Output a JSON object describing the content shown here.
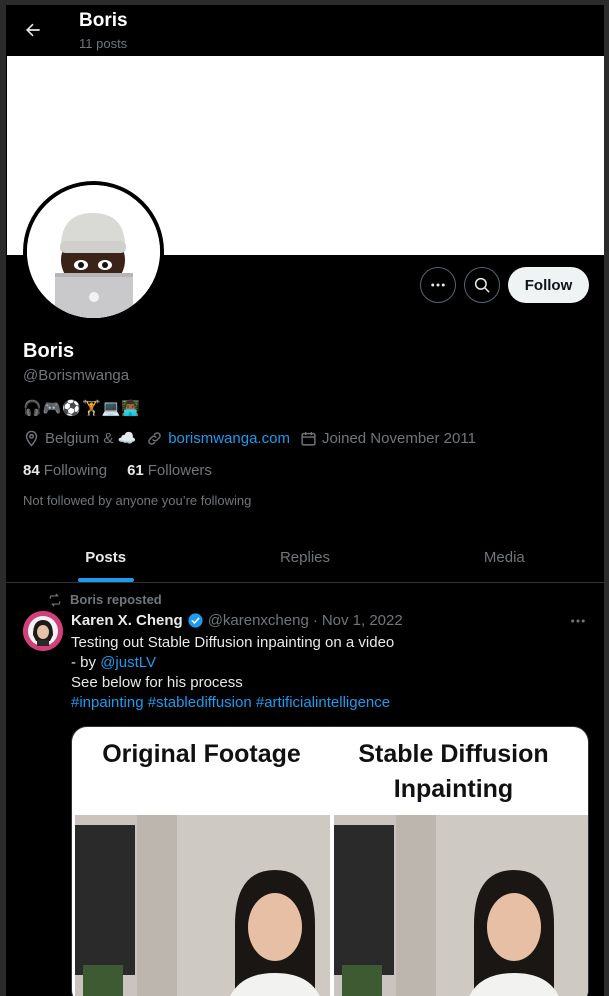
{
  "header": {
    "name": "Boris",
    "post_count": "11 posts"
  },
  "actions": {
    "follow_label": "Follow"
  },
  "profile": {
    "name": "Boris",
    "handle": "@Borismwanga",
    "bio": "🎧🎮⚽🏋💻👨🏾‍💻",
    "location": "Belgium & ☁️",
    "website": "borismwanga.com",
    "joined": "Joined November 2011",
    "following_count": "84",
    "following_label": "Following",
    "followers_count": "61",
    "followers_label": "Followers",
    "not_followed": "Not followed by anyone you’re following"
  },
  "tabs": [
    {
      "label": "Posts",
      "active": true
    },
    {
      "label": "Replies",
      "active": false
    },
    {
      "label": "Media",
      "active": false
    }
  ],
  "tweet": {
    "repost_label": "Boris reposted",
    "author": "Karen X. Cheng",
    "handle": "@karenxcheng",
    "dot": "·",
    "date": "Nov 1, 2022",
    "line1": "Testing out Stable Diffusion inpainting on a video",
    "line2_prefix": "- by ",
    "line2_mention": "@justLV",
    "line3": "See below for his process",
    "hashtags": "#inpainting #stablediffusion #artificialintelligence",
    "media_left_title": "Original Footage",
    "media_right_title": "Stable Diffusion Inpainting"
  },
  "colors": {
    "accent": "#1d9bf0",
    "background": "#000000",
    "muted": "#71767b"
  },
  "icons": [
    "back-arrow-icon",
    "more-icon",
    "search-icon",
    "location-icon",
    "link-icon",
    "calendar-icon",
    "repost-icon",
    "verified-icon"
  ]
}
